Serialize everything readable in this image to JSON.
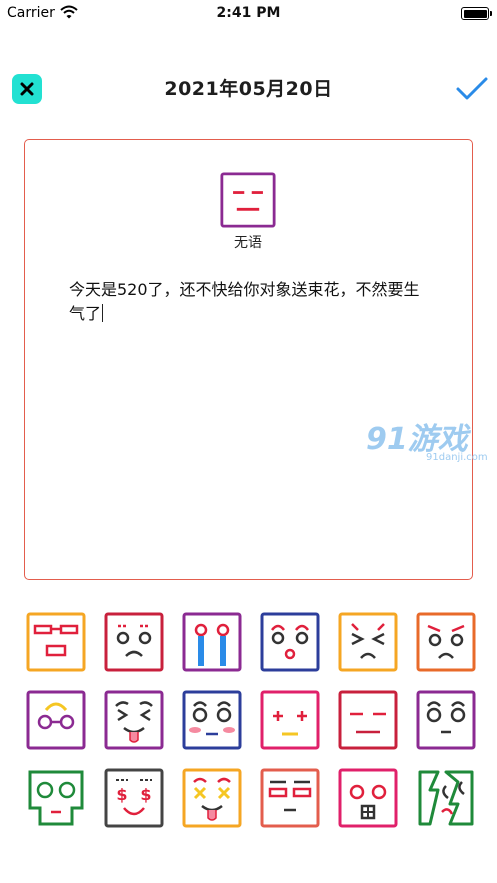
{
  "status_bar": {
    "carrier": "Carrier",
    "time": "2:41 PM"
  },
  "header": {
    "title": "2021年05月20日",
    "close_icon": "close-icon",
    "confirm_icon": "checkmark-icon",
    "close_color": "#22e1d2",
    "confirm_color": "#2a8be8"
  },
  "editor": {
    "border_color": "#e35d4d",
    "selected_mood": {
      "label": "无语",
      "icon": "speechless-face-icon",
      "color": "#8b2a92"
    },
    "note_text": "今天是520了，还不快给你对象送束花，不然要生气了"
  },
  "watermark": {
    "brand": "91游戏",
    "domain": "91danji.com"
  },
  "moods": [
    {
      "icon": "robot-face-icon",
      "color": "#f5a623"
    },
    {
      "icon": "sad-face-icon",
      "color": "#c8203c"
    },
    {
      "icon": "crying-face-icon",
      "color": "#8b2a92"
    },
    {
      "icon": "surprised-face-icon",
      "color": "#2c3e9b"
    },
    {
      "icon": "squint-face-icon",
      "color": "#f5a623"
    },
    {
      "icon": "angry-face-icon",
      "color": "#e86a2a"
    },
    {
      "icon": "glasses-face-icon",
      "color": "#8b2a92"
    },
    {
      "icon": "tongue-face-icon",
      "color": "#8b2a92"
    },
    {
      "icon": "blushing-face-icon",
      "color": "#2c3e9b"
    },
    {
      "icon": "plus-eyes-face-icon",
      "color": "#e0206a"
    },
    {
      "icon": "speechless-face-icon",
      "color": "#c8203c"
    },
    {
      "icon": "worried-face-icon",
      "color": "#8b2a92"
    },
    {
      "icon": "skull-face-icon",
      "color": "#1f8a3a"
    },
    {
      "icon": "money-face-icon",
      "color": "#444444"
    },
    {
      "icon": "dizzy-face-icon",
      "color": "#f5a623"
    },
    {
      "icon": "flat-face-icon",
      "color": "#e35d4d"
    },
    {
      "icon": "shocked-face-icon",
      "color": "#e0206a"
    },
    {
      "icon": "broken-face-icon",
      "color": "#1f8a3a"
    }
  ]
}
